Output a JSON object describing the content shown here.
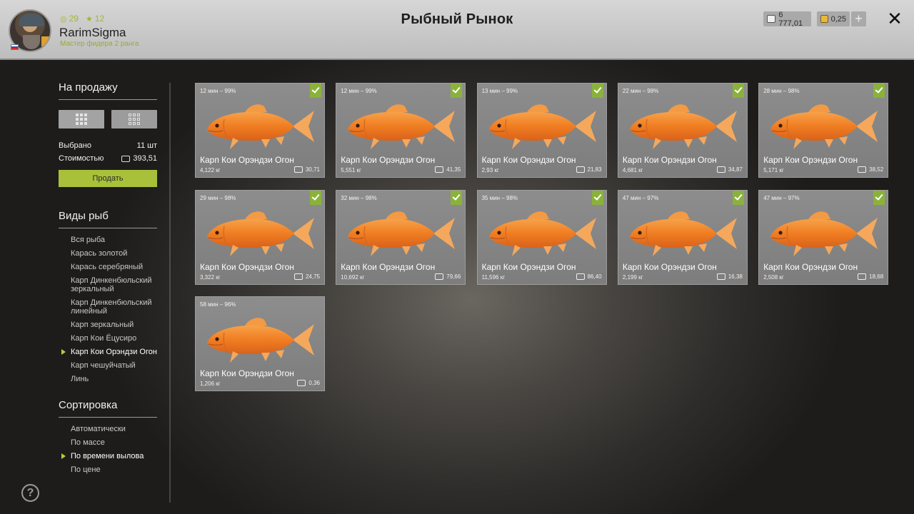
{
  "header": {
    "stat_coins": "29",
    "stat_stars": "12",
    "username": "RarimSigma",
    "rank": "Мастер фидера 2 ранга",
    "title": "Рыбный Рынок",
    "silver": "6 777,01",
    "gold": "0,25",
    "plus": "+",
    "close": "✕",
    "colors": {
      "accent": "#a9c13a",
      "header_bg": "#c8c8c8"
    }
  },
  "sidebar": {
    "sale_title": "На продажу",
    "selected_label": "Выбрано",
    "selected_value": "11 шт",
    "cost_label": "Стоимостью",
    "cost_value": "393,51",
    "sell_label": "Продать",
    "species_title": "Виды рыб",
    "species": [
      {
        "label": "Вся рыба",
        "active": false
      },
      {
        "label": "Карась золотой",
        "active": false
      },
      {
        "label": "Карась серебряный",
        "active": false
      },
      {
        "label": "Карп Динкенбюльский зеркальный",
        "active": false
      },
      {
        "label": "Карп Динкенбюльский линейный",
        "active": false
      },
      {
        "label": "Карп зеркальный",
        "active": false
      },
      {
        "label": "Карп Кои Ёцусиро",
        "active": false
      },
      {
        "label": "Карп Кои Орэндзи Огон",
        "active": true
      },
      {
        "label": "Карп чешуйчатый",
        "active": false
      },
      {
        "label": "Линь",
        "active": false
      }
    ],
    "sort_title": "Сортировка",
    "sort": [
      {
        "label": "Автоматически",
        "active": false
      },
      {
        "label": "По массе",
        "active": false
      },
      {
        "label": "По времени вылова",
        "active": true
      },
      {
        "label": "По цене",
        "active": false
      }
    ],
    "help": "?"
  },
  "cards": [
    {
      "meta": "12 мин – 99%",
      "name": "Карп Кои Орэндзи Огон",
      "weight": "4,122 кг",
      "price": "30,71",
      "checked": true
    },
    {
      "meta": "12 мин – 99%",
      "name": "Карп Кои Орэндзи Огон",
      "weight": "5,551 кг",
      "price": "41,35",
      "checked": true
    },
    {
      "meta": "13 мин – 99%",
      "name": "Карп Кои Орэндзи Огон",
      "weight": "2,93 кг",
      "price": "21,83",
      "checked": true
    },
    {
      "meta": "22 мин – 98%",
      "name": "Карп Кои Орэндзи Огон",
      "weight": "4,681 кг",
      "price": "34,87",
      "checked": true
    },
    {
      "meta": "28 мин – 98%",
      "name": "Карп Кои Орэндзи Огон",
      "weight": "5,171 кг",
      "price": "38,52",
      "checked": true
    },
    {
      "meta": "29 мин – 98%",
      "name": "Карп Кои Орэндзи Огон",
      "weight": "3,322 кг",
      "price": "24,75",
      "checked": true
    },
    {
      "meta": "32 мин – 98%",
      "name": "Карп Кои Орэндзи Огон",
      "weight": "10,692 кг",
      "price": "79,66",
      "checked": true
    },
    {
      "meta": "35 мин – 98%",
      "name": "Карп Кои Орэндзи Огон",
      "weight": "11,596 кг",
      "price": "86,40",
      "checked": true
    },
    {
      "meta": "47 мин – 97%",
      "name": "Карп Кои Орэндзи Огон",
      "weight": "2,199 кг",
      "price": "16,38",
      "checked": true
    },
    {
      "meta": "47 мин – 97%",
      "name": "Карп Кои Орэндзи Огон",
      "weight": "2,508 кг",
      "price": "18,68",
      "checked": true
    },
    {
      "meta": "58 мин – 96%",
      "name": "Карп Кои Орэндзи Огон",
      "weight": "1,206 кг",
      "price": "0,36",
      "checked": false
    }
  ]
}
